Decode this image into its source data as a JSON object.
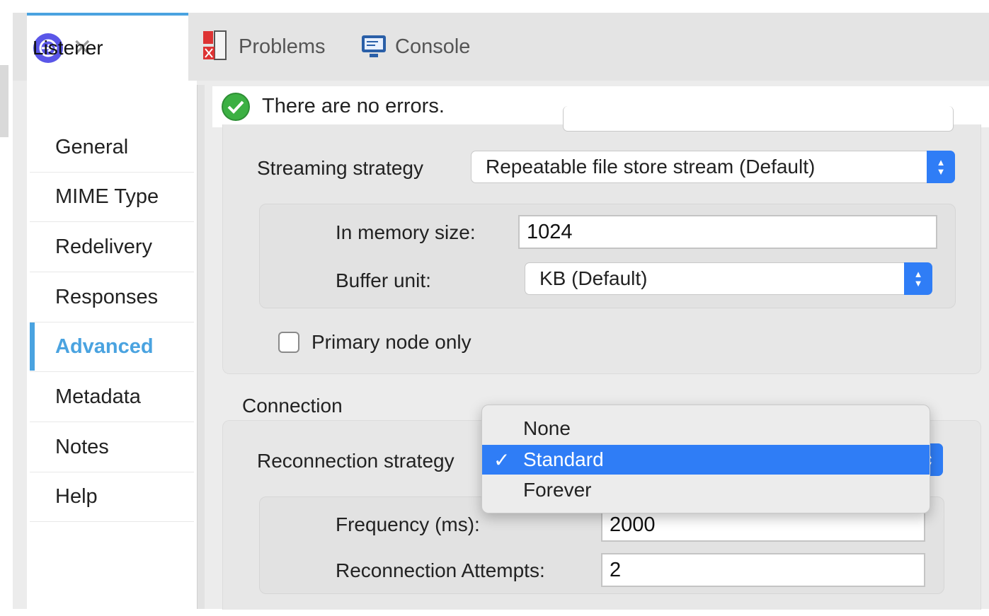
{
  "tabs": [
    {
      "label": "Listener",
      "icon": "listener-icon",
      "active": true,
      "closable": true
    },
    {
      "label": "Problems",
      "icon": "problems-icon",
      "active": false
    },
    {
      "label": "Console",
      "icon": "console-icon",
      "active": false
    }
  ],
  "status": {
    "text": "There are no errors.",
    "icon": "check-circle-icon"
  },
  "sidebar": {
    "items": [
      {
        "label": "General"
      },
      {
        "label": "MIME Type"
      },
      {
        "label": "Redelivery"
      },
      {
        "label": "Responses"
      },
      {
        "label": "Advanced",
        "active": true
      },
      {
        "label": "Metadata"
      },
      {
        "label": "Notes"
      },
      {
        "label": "Help"
      }
    ]
  },
  "streaming": {
    "strategy_label": "Streaming strategy",
    "strategy_value": "Repeatable file store stream (Default)",
    "memory_label": "In memory size:",
    "memory_value": "1024",
    "buffer_label": "Buffer unit:",
    "buffer_value": "KB (Default)",
    "primary_node_label": "Primary node only",
    "primary_node_checked": false
  },
  "connection": {
    "section_label": "Connection",
    "reconnection_label": "Reconnection strategy",
    "options": [
      "None",
      "Standard",
      "Forever"
    ],
    "selected_option": "Standard",
    "check_mark": "✓",
    "frequency_label": "Frequency (ms):",
    "frequency_value": "2000",
    "attempts_label": "Reconnection Attempts:",
    "attempts_value": "2"
  },
  "colors": {
    "accent": "#4aa3e0",
    "select_blue": "#2f7df6",
    "success_green": "#3cb043"
  }
}
